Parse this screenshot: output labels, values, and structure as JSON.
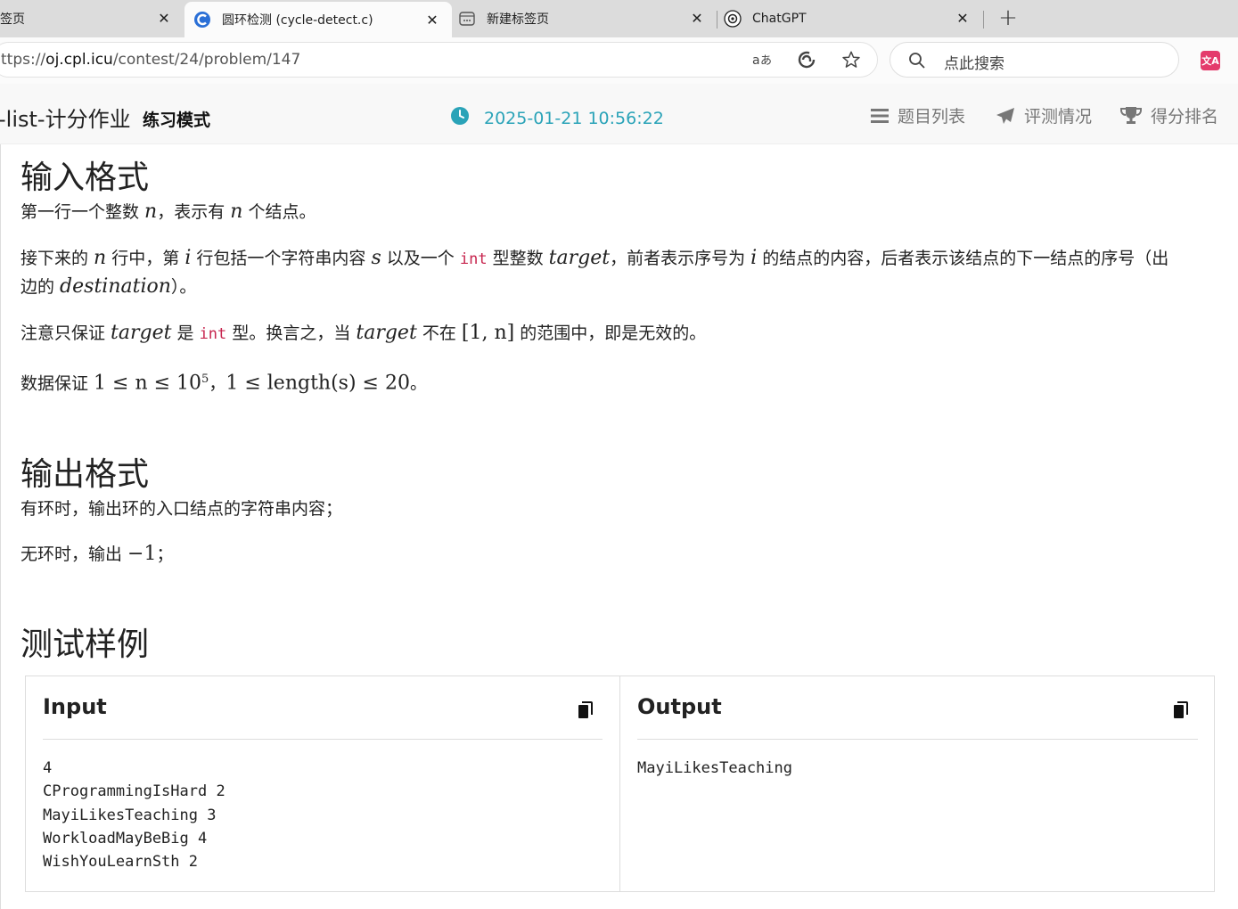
{
  "tabs": [
    {
      "label": "签页"
    },
    {
      "label": "圆环检测 (cycle-detect.c)"
    },
    {
      "label": "新建标签页"
    },
    {
      "label": "ChatGPT"
    }
  ],
  "address_bar": {
    "scheme_prefix": "ttps://",
    "host": "oj.cpl.icu",
    "path": "/contest/24/problem/147",
    "search_placeholder": "点此搜索"
  },
  "site": {
    "brand": "-list-计分作业",
    "mode": "练习模式",
    "clock": "2025-01-21 10:56:22",
    "nav": [
      "题目列表",
      "评测情况",
      "得分排名"
    ]
  },
  "colors": {
    "accent": "#2aa3b8",
    "code": "#c7254e"
  },
  "input_section": {
    "heading": "输入格式",
    "p1": {
      "a": "第一行一个整数 ",
      "n1": "n",
      "b": "，表示有 ",
      "n2": "n",
      "c": " 个结点。"
    },
    "p2": {
      "a": "接下来的 ",
      "n": "n",
      "b": " 行中，第 ",
      "i": "i",
      "c": " 行包括一个字符串内容 ",
      "s": "s",
      "d": " 以及一个 ",
      "code": "int",
      "e": " 型整数 ",
      "target": "target",
      "f": "，前者表示序号为 ",
      "i2": "i",
      "g": " 的结点的内容，后者表示该结点的下一结点的序号（出",
      "h": "边的 ",
      "dest": "destination",
      "k": "）。"
    },
    "p3": {
      "a": "注意只保证 ",
      "target1": "target",
      "b": " 是 ",
      "code": "int",
      "c": " 型。换言之，当 ",
      "target2": "target",
      "d": " 不在 ",
      "range": "[1, n]",
      "e": " 的范围中，即是无效的。"
    },
    "p4": {
      "a": "数据保证 ",
      "math1": "1 ≤ n ≤ 10",
      "sup": "5",
      "b": "，",
      "math2": "1 ≤ length(s) ≤ 20",
      "c": "。"
    }
  },
  "output_section": {
    "heading": "输出格式",
    "p1": "有环时，输出环的入口结点的字符串内容；",
    "p2": {
      "a": "无环时，输出 ",
      "math": "−1",
      "b": "；"
    }
  },
  "sample_section": {
    "heading": "测试样例",
    "input_title": "Input",
    "output_title": "Output",
    "input_lines": [
      "4",
      "CProgrammingIsHard 2",
      "MayiLikesTeaching 3",
      "WorkloadMayBeBig 4",
      "WishYouLearnSth 2"
    ],
    "output_lines": [
      "MayiLikesTeaching"
    ]
  }
}
